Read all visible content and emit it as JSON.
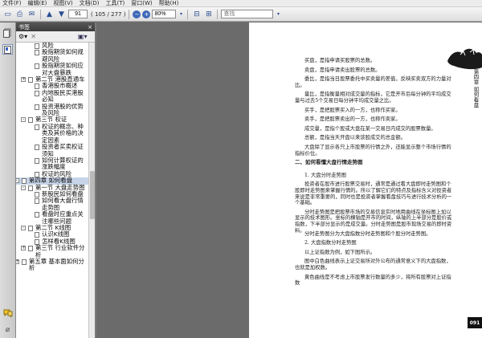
{
  "menu": [
    "文件(F)",
    "编辑(E)",
    "视图(V)",
    "文档(D)",
    "工具(T)",
    "窗口(W)",
    "帮助(H)"
  ],
  "toolbar": {
    "page_current": "91",
    "page_total": "( 105 / 277 )",
    "zoom": "80%",
    "search_placeholder": "查找"
  },
  "bookmarks_panel": {
    "title": "书签",
    "close_symbol": "×",
    "items": [
      {
        "text": "风险",
        "level": 4,
        "toggle": null,
        "selected": false
      },
      {
        "text": "股指期货如何规避风险",
        "level": 4,
        "toggle": null,
        "selected": false
      },
      {
        "text": "股指期货如何应对大盘暴跌",
        "level": 4,
        "toggle": null,
        "selected": false
      },
      {
        "text": "第二节  港股直通车",
        "level": 3,
        "toggle": "+",
        "selected": false
      },
      {
        "text": "香港股市概述",
        "level": 4,
        "toggle": null,
        "selected": false
      },
      {
        "text": "内地股民买港股必知",
        "level": 4,
        "toggle": null,
        "selected": false
      },
      {
        "text": "投资港股的优势及风险",
        "level": 4,
        "toggle": null,
        "selected": false
      },
      {
        "text": "第三节  权证",
        "level": 3,
        "toggle": "-",
        "selected": false
      },
      {
        "text": "权证的概念、种类及其价格的决定因素",
        "level": 4,
        "toggle": null,
        "selected": false
      },
      {
        "text": "投资者买卖权证须知",
        "level": 4,
        "toggle": null,
        "selected": false
      },
      {
        "text": "如何计算权证的涨跌幅度",
        "level": 4,
        "toggle": null,
        "selected": false
      },
      {
        "text": "权证的风险",
        "level": 4,
        "toggle": null,
        "selected": false
      },
      {
        "text": "第四章  如何看盘",
        "level": 2,
        "toggle": "-",
        "selected": true
      },
      {
        "text": "第一节  大盘走势图",
        "level": 3,
        "toggle": "-",
        "selected": false
      },
      {
        "text": "新股民如何看盘",
        "level": 4,
        "toggle": null,
        "selected": false
      },
      {
        "text": "如何看大盘行情走势图",
        "level": 4,
        "toggle": null,
        "selected": false
      },
      {
        "text": "看盘时应重点关注哪些问题",
        "level": 4,
        "toggle": null,
        "selected": false
      },
      {
        "text": "第二节  K线图",
        "level": 3,
        "toggle": "-",
        "selected": false
      },
      {
        "text": "认识K线图",
        "level": 4,
        "toggle": null,
        "selected": false
      },
      {
        "text": "怎样看K线图",
        "level": 4,
        "toggle": null,
        "selected": false
      },
      {
        "text": "第三节  行业软件分析",
        "level": 3,
        "toggle": "+",
        "selected": false
      },
      {
        "text": "第五章  基本面如何分析",
        "level": 2,
        "toggle": "+",
        "selected": false
      }
    ]
  },
  "page": {
    "chapter_label": "第四章  如何看盘",
    "page_number": "091",
    "paragraphs": [
      {
        "text": "买盘，是指申请买股票的总数。",
        "indent": true
      },
      {
        "text": "卖盘，是指申请卖出股票的总数。",
        "indent": true
      },
      {
        "text": "委比，是指当日股票委托中买卖量的差值，反映买卖双方的力量对比。",
        "indent": true
      },
      {
        "text": "量比，是指衡量相对成交量的指标，它是开市后每分钟的平均成交量与过去5个交易日每分钟平均成交量之比。",
        "indent": true
      },
      {
        "text": "买手，是把股票买入的一方，也称作买家。",
        "indent": true
      },
      {
        "text": "卖手，是把股票卖出的一方，也称作卖家。",
        "indent": true
      },
      {
        "text": "成交量，是指个股或大盘在某一交易日内成交的股票数量。",
        "indent": true
      },
      {
        "text": "总额，是指当天开盘以来该股成交的总金额。",
        "indent": true
      },
      {
        "text": "大盘除了显示各只上市股票的行情之外，还能显示整个市场行情的指标价位。",
        "indent": true
      },
      {
        "text": "二、如何看懂大盘行情走势图",
        "indent": false,
        "head": true
      },
      {
        "text": "1. 大盘分时走势图",
        "indent": true
      },
      {
        "text": "投资者在股市进行股票交易时，通常是通过看大盘即时走势图和个股即时走势图来掌握行情的。所以了解它们的特点及指标含义对投资者来说是非常重要的，同时也是投资者掌握看盘技巧与进行技术分析的一个基础。",
        "indent": true
      },
      {
        "text": "分时走势图是把股票市场的交易信息实时地用曲线在坐标图上加以显示的技术图形。坐标的横轴是开市的时间，纵轴的上半部分是股价或指数，下半部分显示的是成交量。分时走势图是股市现场交易的即时资料。",
        "indent": true
      },
      {
        "text": "分时走势图分为大盘指数分时走势图和个股分时走势图。",
        "indent": true
      },
      {
        "text": "2. 大盘指数分时走势图",
        "indent": true
      },
      {
        "text": "以上证指数为例，如下图所示。",
        "indent": true
      },
      {
        "text": "图中白色曲线表示上证交易所对外公布的通常意义下的大盘指数，也就是加权数。",
        "indent": true
      },
      {
        "text": "黄色曲线是不考虑上市股票发行数量的多少，将所有股票对上证指数",
        "indent": true
      }
    ]
  }
}
